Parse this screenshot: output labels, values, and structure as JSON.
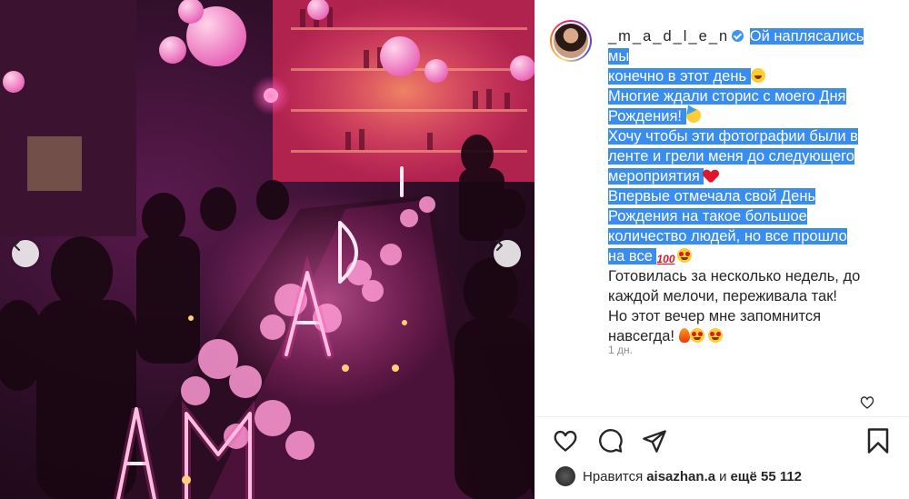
{
  "post": {
    "username": "_m_a_d_l_e_n",
    "caption_lines": [
      "Ой наплясались мы",
      "конечно в этот день",
      "Многие ждали сторис с моего Дня",
      "Рождения!",
      "Хочу чтобы эти фотографии были в",
      "ленте и грели меня до следующего",
      "мероприятия",
      "Впервые отмечала свой День",
      "Рождения на такое большое",
      "количество людей, но все прошло",
      "на все",
      "Готовилась за несколько недель, до",
      "каждой мелочи, переживала так!",
      "Но этот вечер мне запомнится",
      "навсегда!"
    ],
    "timestamp": "1 дн."
  },
  "likes": {
    "prefix": "Нравится",
    "user": "aisazhan.a",
    "middle": "и",
    "suffix": "ещё 55 112"
  },
  "icons": {
    "prev": "chevron-left-icon",
    "next": "chevron-right-icon",
    "like": "heart-icon",
    "comment": "comment-icon",
    "share": "share-icon",
    "save": "bookmark-icon",
    "verified": "verified-badge-icon"
  },
  "colors": {
    "selection": "#3a8df0",
    "verified": "#3897f0",
    "neon": "#ff3fae"
  }
}
